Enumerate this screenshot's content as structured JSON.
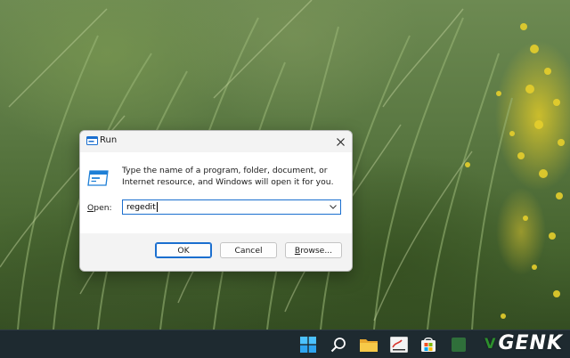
{
  "dialog": {
    "title": "Run",
    "description": "Type the name of a program, folder, document, or Internet resource, and Windows will open it for you.",
    "open_label_mnemonic": "O",
    "open_label_rest": "pen:",
    "open_value": "regedit",
    "buttons": {
      "ok": "OK",
      "cancel": "Cancel",
      "browse_mnemonic": "B",
      "browse_rest": "rowse..."
    },
    "close_icon": "close-icon",
    "app_icon": "run-icon"
  },
  "taskbar": {
    "icons": [
      "windows-start-icon",
      "search-icon",
      "file-explorer-icon",
      "paint-icon",
      "store-icon",
      "app-icon"
    ]
  },
  "watermark": {
    "v": "V",
    "text": "GENK"
  },
  "colors": {
    "accent": "#1b6fcf",
    "taskbar": "#1e2a30",
    "dialog_bg": "#f3f3f3",
    "folder": "#f2b33d"
  }
}
